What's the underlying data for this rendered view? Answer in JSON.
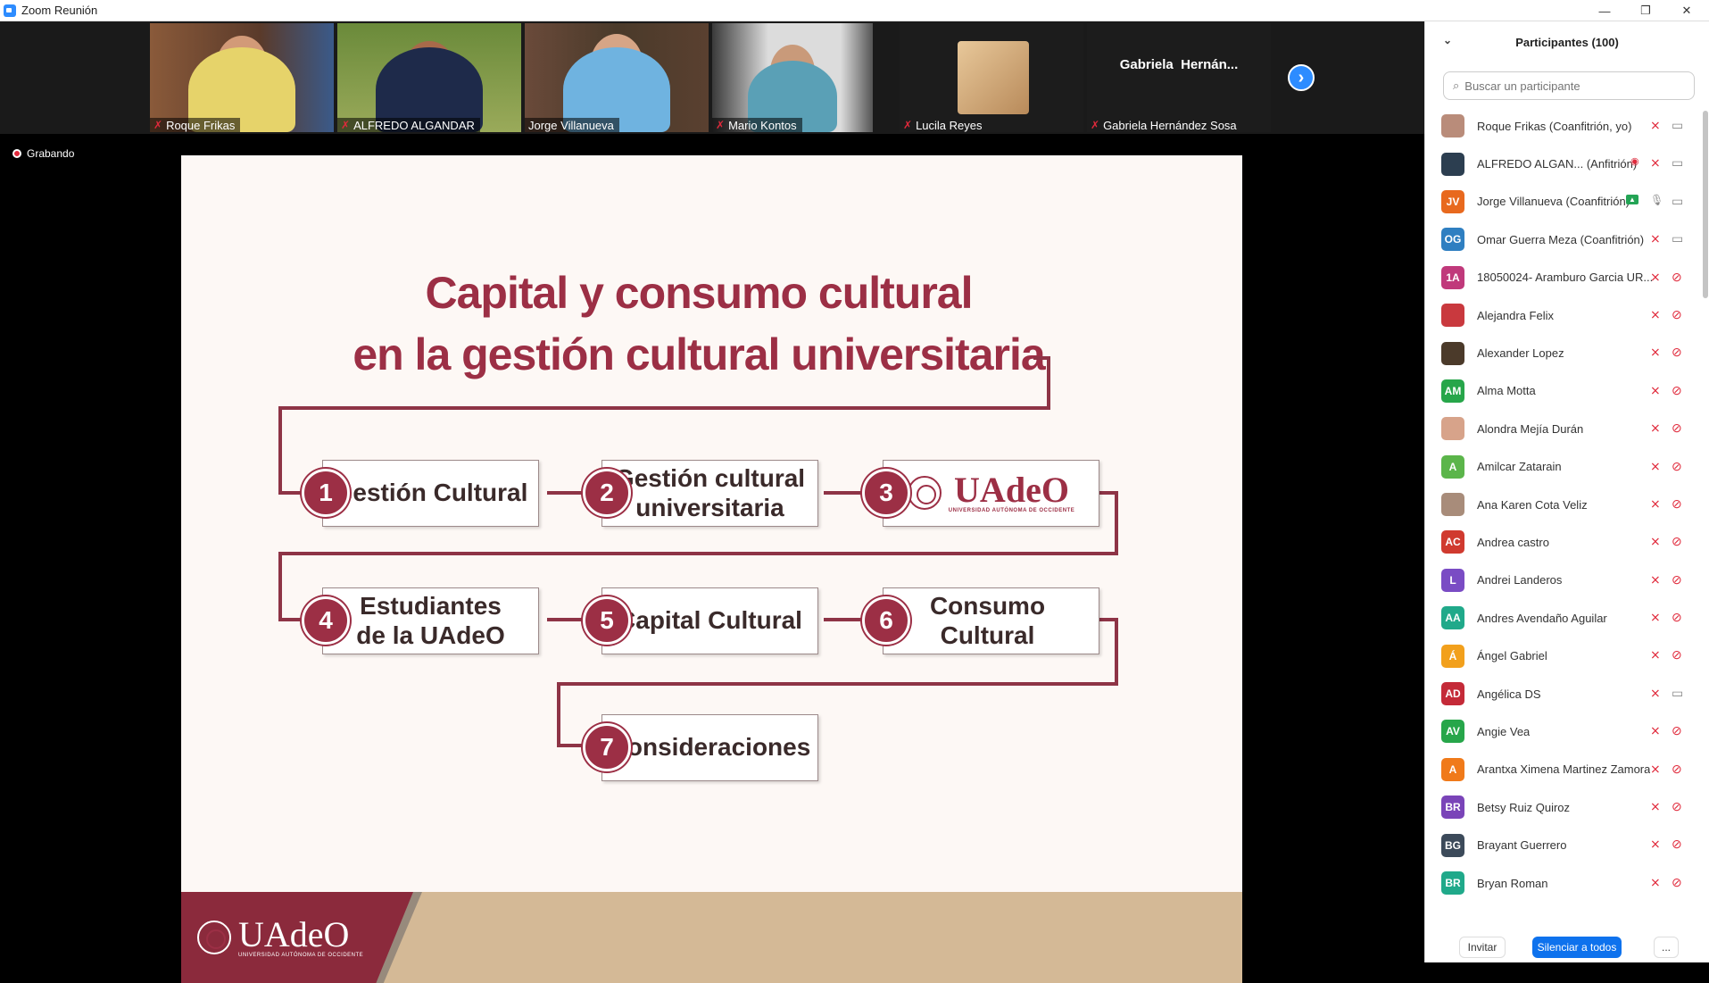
{
  "window": {
    "title": "Zoom Reunión",
    "minimize": "—",
    "restore": "❐",
    "close": "✕"
  },
  "strip": {
    "participants": [
      {
        "name": "Roque Frikas",
        "muted": true
      },
      {
        "name": "ALFREDO ALGANDAR",
        "muted": true
      },
      {
        "name": "Jorge Villanueva",
        "muted": false
      },
      {
        "name": "Mario Kontos",
        "muted": true
      },
      {
        "name": "Lucila Reyes",
        "muted": true
      },
      {
        "name": "Gabriela Hernández Sosa",
        "muted": true,
        "tile_label": "Gabriela  Hernán..."
      }
    ],
    "next_icon": "chevron-right-icon"
  },
  "recording": {
    "label": "Grabando"
  },
  "slide": {
    "title_line1": "Capital y consumo cultural",
    "title_line2": "en la gestión cultural universitaria",
    "items": [
      {
        "number": "1",
        "label": "Gestión Cultural"
      },
      {
        "number": "2",
        "label": "Gestión cultural universitaria"
      },
      {
        "number": "3",
        "label": "UAdeO"
      },
      {
        "number": "4",
        "label": "Estudiantes de la UAdeO"
      },
      {
        "number": "5",
        "label": "Capital Cultural"
      },
      {
        "number": "6",
        "label": "Consumo Cultural"
      },
      {
        "number": "7",
        "label": "Consideraciones"
      }
    ],
    "logo_text": "UAdeO",
    "logo_subtext": "UNIVERSIDAD AUTÓNOMA DE OCCIDENTE",
    "accent_color": "#9c2f45"
  },
  "panel": {
    "title": "Participantes (100)",
    "search_placeholder": "Buscar un participante",
    "participants": [
      {
        "name": "Roque Frikas (Coanfitrión, yo)",
        "initials": "",
        "color": "#b98c7a",
        "photo": true,
        "mic": "muted",
        "cam": "on"
      },
      {
        "name": "ALFREDO ALGAN... (Anfitrión)",
        "initials": "",
        "color": "#2c3e50",
        "photo": true,
        "mic": "muted",
        "cam": "on",
        "recording": true
      },
      {
        "name": "Jorge Villanueva (Coanfitrión)",
        "initials": "JV",
        "color": "#e8691e",
        "mic": "on",
        "cam": "on",
        "share": true
      },
      {
        "name": "Omar Guerra Meza (Coanfitrión)",
        "initials": "OG",
        "color": "#2f7fc1",
        "mic": "muted",
        "cam": "on"
      },
      {
        "name": "18050024- Aramburo Garcia UR...",
        "initials": "1A",
        "color": "#c0397b",
        "mic": "muted",
        "cam": "off"
      },
      {
        "name": "Alejandra Felix",
        "initials": "",
        "color": "#c9393e",
        "photo": true,
        "mic": "muted",
        "cam": "off"
      },
      {
        "name": "Alexander Lopez",
        "initials": "",
        "color": "#4b3a2a",
        "photo": true,
        "mic": "muted",
        "cam": "off"
      },
      {
        "name": "Alma Motta",
        "initials": "AM",
        "color": "#27a64a",
        "mic": "muted",
        "cam": "off"
      },
      {
        "name": "Alondra Mejía Durán",
        "initials": "",
        "color": "#d7a38a",
        "photo": true,
        "mic": "muted",
        "cam": "off"
      },
      {
        "name": "Amilcar Zatarain",
        "initials": "A",
        "color": "#5bb54a",
        "mic": "muted",
        "cam": "off"
      },
      {
        "name": "Ana Karen Cota Veliz",
        "initials": "",
        "color": "#a88c7a",
        "photo": true,
        "mic": "muted",
        "cam": "off"
      },
      {
        "name": "Andrea castro",
        "initials": "AC",
        "color": "#d03a2f",
        "mic": "muted",
        "cam": "off"
      },
      {
        "name": "Andrei Landeros",
        "initials": "L",
        "color": "#7a4cc4",
        "mic": "muted",
        "cam": "off"
      },
      {
        "name": "Andres Avendaño Aguilar",
        "initials": "AA",
        "color": "#20a98a",
        "mic": "muted",
        "cam": "off"
      },
      {
        "name": "Ángel Gabriel",
        "initials": "Á",
        "color": "#f2a01c",
        "mic": "muted",
        "cam": "off"
      },
      {
        "name": "Angélica DS",
        "initials": "AD",
        "color": "#c42a38",
        "mic": "muted",
        "cam": "on"
      },
      {
        "name": "Angie Vea",
        "initials": "AV",
        "color": "#27a64a",
        "mic": "muted",
        "cam": "off"
      },
      {
        "name": "Arantxa Ximena Martinez Zamora",
        "initials": "A",
        "color": "#f07a1a",
        "mic": "muted",
        "cam": "off"
      },
      {
        "name": "Betsy Ruiz Quiroz",
        "initials": "BR",
        "color": "#7a44b8",
        "mic": "muted",
        "cam": "off"
      },
      {
        "name": "Brayant Guerrero",
        "initials": "BG",
        "color": "#3c4a5a",
        "mic": "muted",
        "cam": "off"
      },
      {
        "name": "Bryan Roman",
        "initials": "BR",
        "color": "#20a98a",
        "mic": "muted",
        "cam": "off"
      }
    ],
    "invite_label": "Invitar",
    "mute_all_label": "Silenciar a todos",
    "more_label": "..."
  }
}
